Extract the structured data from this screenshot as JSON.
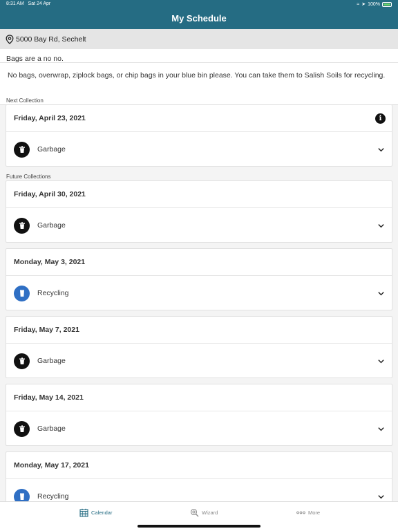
{
  "status": {
    "time": "8:31 AM",
    "date": "Sat 24 Apr",
    "battery": "100%"
  },
  "header": {
    "title": "My Schedule"
  },
  "address": {
    "text": "5000 Bay Rd, Sechelt"
  },
  "notice": {
    "title": "Bags are a no no.",
    "text": "No bags, overwrap, ziplock bags, or chip bags in your blue bin please. You can take them to Salish Soils for recycling."
  },
  "sections": {
    "next": "Next Collection",
    "future": "Future Collections"
  },
  "collections": [
    {
      "date": "Friday, April 23, 2021",
      "type": "Garbage",
      "icon": "garbage-bin-icon",
      "color": "#111111"
    },
    {
      "date": "Friday, April 30, 2021",
      "type": "Garbage",
      "icon": "garbage-bin-icon",
      "color": "#111111"
    },
    {
      "date": "Monday, May 3, 2021",
      "type": "Recycling",
      "icon": "recycling-bin-icon",
      "color": "#2f6fc4"
    },
    {
      "date": "Friday, May 7, 2021",
      "type": "Garbage",
      "icon": "garbage-bin-icon",
      "color": "#111111"
    },
    {
      "date": "Friday, May 14, 2021",
      "type": "Garbage",
      "icon": "garbage-bin-icon",
      "color": "#111111"
    },
    {
      "date": "Monday, May 17, 2021",
      "type": "Recycling",
      "icon": "recycling-bin-icon",
      "color": "#2f6fc4"
    }
  ],
  "tabs": [
    {
      "label": "Calendar",
      "icon": "calendar-icon",
      "active": true
    },
    {
      "label": "Wizard",
      "icon": "magnifier-icon",
      "active": false
    },
    {
      "label": "More",
      "icon": "more-dots-icon",
      "active": false
    }
  ],
  "colors": {
    "header": "#256c83",
    "accent": "#256c83",
    "recycling": "#2f6fc4",
    "garbage": "#111111"
  }
}
